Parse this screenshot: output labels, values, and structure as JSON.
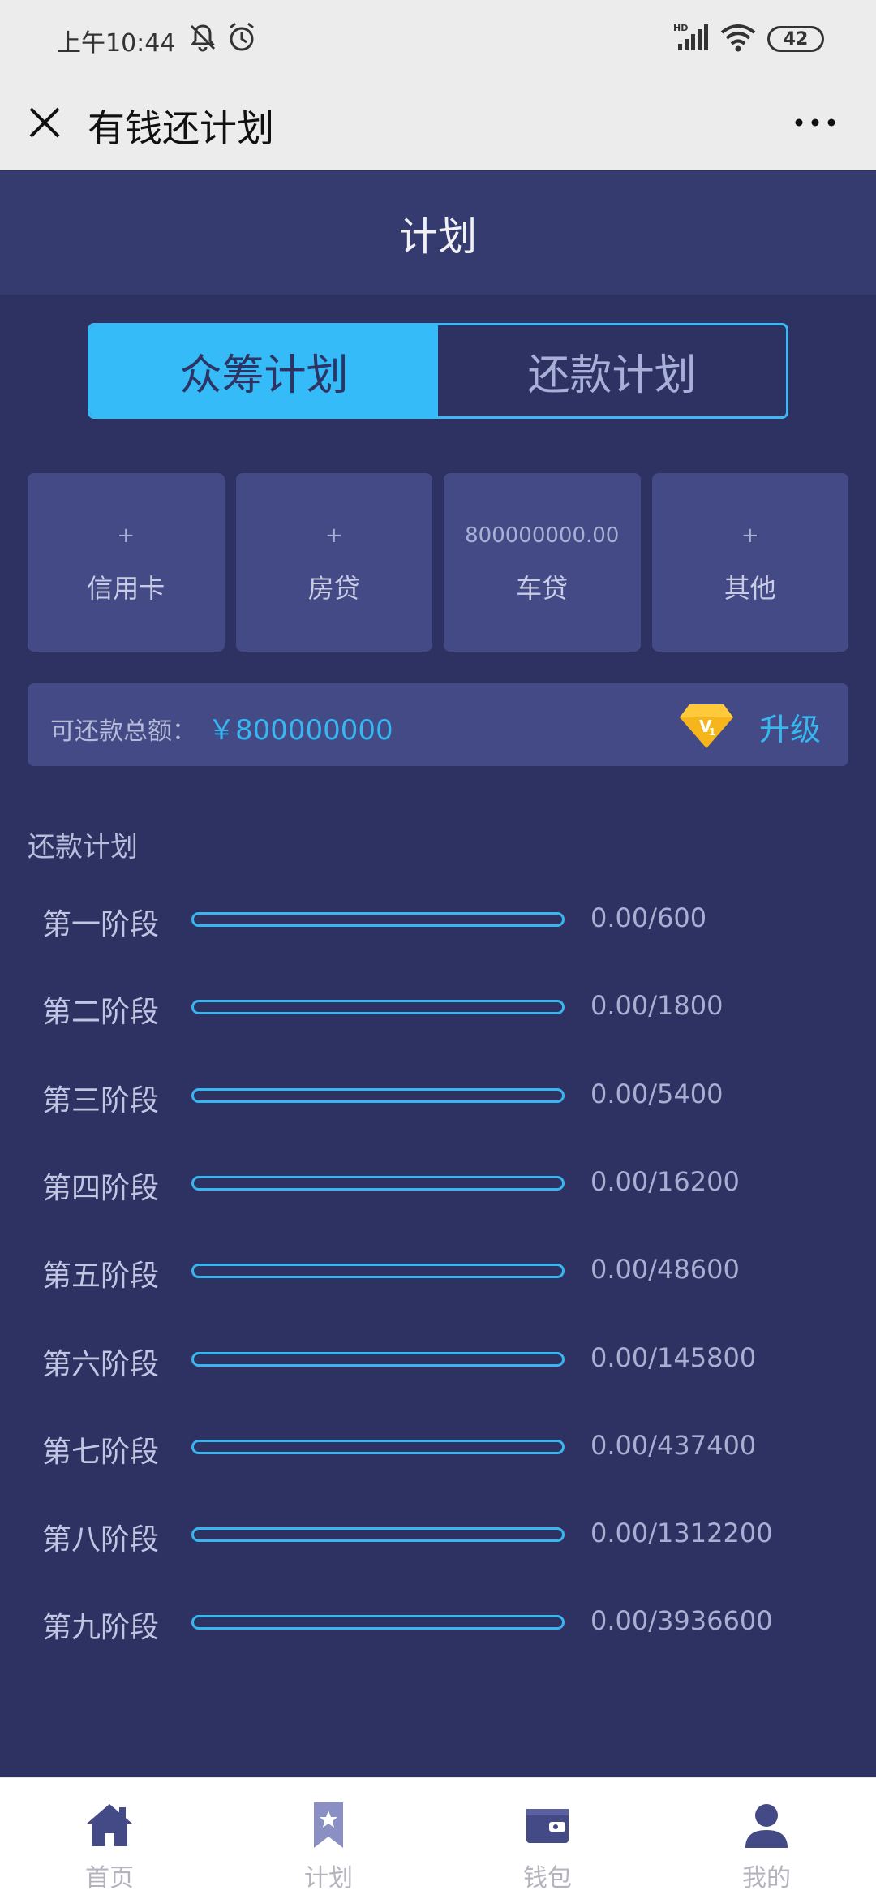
{
  "status_bar": {
    "time": "上午10:44",
    "battery": "42",
    "icons": [
      "mute-bell-icon",
      "alarm-icon",
      "signal-icon",
      "wifi-icon",
      "battery-icon"
    ]
  },
  "title_bar": {
    "title": "有钱还计划",
    "close_icon": "close-icon",
    "more_icon": "more-icon"
  },
  "header": {
    "title": "计划"
  },
  "segmented": {
    "tabs": [
      {
        "label": "众筹计划",
        "active": true
      },
      {
        "label": "还款计划",
        "active": false
      }
    ]
  },
  "cards": [
    {
      "value": "+",
      "label": "信用卡"
    },
    {
      "value": "+",
      "label": "房贷"
    },
    {
      "value": "800000000.00",
      "label": "车贷"
    },
    {
      "value": "+",
      "label": "其他"
    }
  ],
  "total": {
    "label": "可还款总额：",
    "amount": "￥800000000",
    "badge_icon": "vip-level-gem-icon",
    "upgrade": "升级"
  },
  "plan": {
    "title": "还款计划",
    "stages": [
      {
        "name": "第一阶段",
        "value": "0.00/600",
        "progress": 0
      },
      {
        "name": "第二阶段",
        "value": "0.00/1800",
        "progress": 0
      },
      {
        "name": "第三阶段",
        "value": "0.00/5400",
        "progress": 0
      },
      {
        "name": "第四阶段",
        "value": "0.00/16200",
        "progress": 0
      },
      {
        "name": "第五阶段",
        "value": "0.00/48600",
        "progress": 0
      },
      {
        "name": "第六阶段",
        "value": "0.00/145800",
        "progress": 0
      },
      {
        "name": "第七阶段",
        "value": "0.00/437400",
        "progress": 0
      },
      {
        "name": "第八阶段",
        "value": "0.00/1312200",
        "progress": 0
      },
      {
        "name": "第九阶段",
        "value": "0.00/3936600",
        "progress": 0
      }
    ]
  },
  "tabbar": {
    "items": [
      {
        "label": "首页",
        "icon": "home-icon"
      },
      {
        "label": "计划",
        "icon": "bookmark-star-icon"
      },
      {
        "label": "钱包",
        "icon": "wallet-icon"
      },
      {
        "label": "我的",
        "icon": "user-icon"
      }
    ]
  },
  "colors": {
    "background": "#2d3263",
    "accent": "#38b6f0",
    "card": "#434a85",
    "gem": "#f7b51c"
  }
}
